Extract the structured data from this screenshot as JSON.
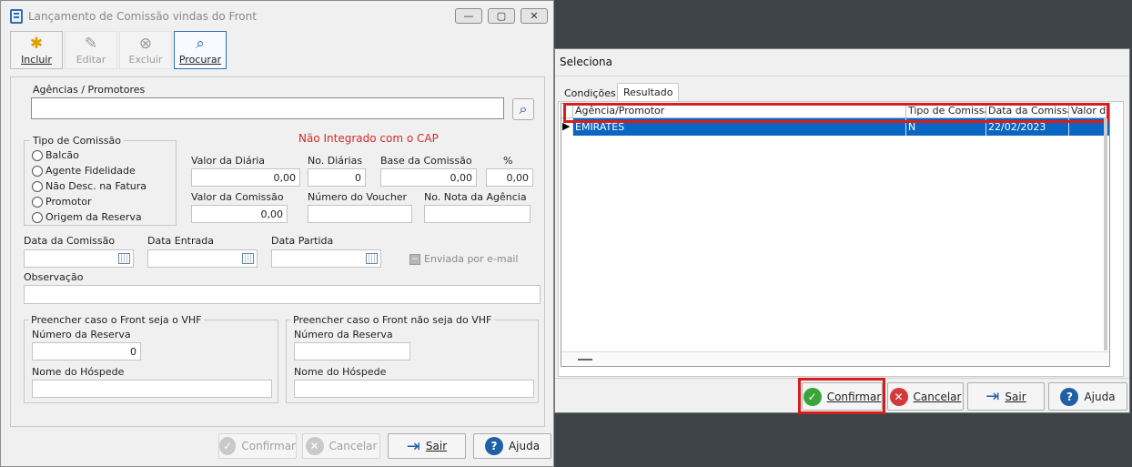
{
  "main_window": {
    "title": "Lançamento de Comissão vindas do Front",
    "toolbar": {
      "incluir": "Incluir",
      "editar": "Editar",
      "excluir": "Excluir",
      "procurar": "Procurar"
    },
    "agencias_label": "Agências  / Promotores",
    "agencias_value": "",
    "status_text": "Não Integrado com o CAP",
    "tipo_comissao": {
      "title": "Tipo de Comissão",
      "options": [
        "Balcão",
        "Agente Fidelidade",
        "Não Desc. na Fatura",
        "Promotor",
        "Origem da Reserva"
      ]
    },
    "fields": {
      "valor_diaria_label": "Valor da Diária",
      "valor_diaria": "0,00",
      "no_diarias_label": "No. Diárias",
      "no_diarias": "0",
      "base_comissao_label": "Base da Comissão",
      "base_comissao": "0,00",
      "pct_label": "%",
      "pct": "0,00",
      "valor_comissao_label": "Valor da Comissão",
      "valor_comissao": "0,00",
      "numero_voucher_label": "Número do Voucher",
      "numero_voucher": "",
      "nota_agencia_label": "No. Nota da Agência",
      "nota_agencia": "",
      "data_comissao_label": "Data da Comissão",
      "data_entrada_label": "Data Entrada",
      "data_partida_label": "Data Partida",
      "enviada_email_label": "Enviada por e-mail",
      "observacao_label": "Observação"
    },
    "vhf": {
      "title": "Preencher caso o Front seja o VHF",
      "reserva_label": "Número da Reserva",
      "reserva": "0",
      "hospede_label": "Nome do Hóspede"
    },
    "nao_vhf": {
      "title": "Preencher caso o Front não seja do VHF",
      "reserva_label": "Número da Reserva",
      "hospede_label": "Nome do Hóspede"
    },
    "buttons": {
      "confirmar": "Confirmar",
      "cancelar": "Cancelar",
      "sair": "Sair",
      "ajuda": "Ajuda"
    }
  },
  "dialog": {
    "title": "Seleciona",
    "tabs": [
      "Condições",
      "Resultado"
    ],
    "columns": [
      "Agência/Promotor",
      "Tipo de Comissão",
      "Data da Comissão",
      "Valor da"
    ],
    "rows": [
      {
        "agencia": "EMIRATES",
        "tipo": "N",
        "data": "22/02/2023",
        "valor": ""
      }
    ],
    "buttons": {
      "confirmar": "Confirmar",
      "cancelar": "Cancelar",
      "sair": "Sair",
      "ajuda": "Ajuda"
    }
  },
  "colors": {
    "highlight": "#d81d1d",
    "selection": "#0a66c2",
    "status_red": "#d42a2a"
  }
}
